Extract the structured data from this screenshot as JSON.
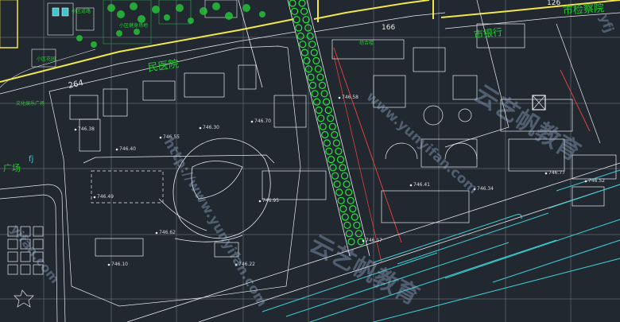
{
  "drawing": {
    "background": "#212830",
    "colors": {
      "boundary": "#f2e64d",
      "green_text": "#1fcf2a",
      "tree": "#22e83a",
      "red_line": "#e0403c",
      "cyan": "#3ec6cc",
      "grid": "#c8d2dc",
      "lines": "#e8ecef"
    }
  },
  "labels": {
    "min_yi_yuan": "民医院",
    "shi_jian_cha_yuan": "市检察院",
    "shi_yin_hang": "市银行",
    "guang_chang": "广场",
    "lot_264": "264",
    "lot_166": "166",
    "lot_126": "126",
    "small_1": "小区道路",
    "small_2": "小区健身场地",
    "small_3": "小区花园",
    "small_4": "文化娱乐广场",
    "small_5": "综合楼",
    "left_tag": "fj"
  },
  "watermarks": {
    "brand_1": "云艺帆教育",
    "brand_2": "云艺帆教育",
    "url_1": "www.yunyifan.com",
    "url_2": "http://www.yunyifan.com",
    "url_3": "yifan.com",
    "url_4": "yfj"
  },
  "annotations": {
    "elev_1": "746.38",
    "elev_2": "746.40",
    "elev_3": "746.55",
    "elev_4": "746.30",
    "elev_5": "746.70",
    "elev_6": "746.49",
    "elev_7": "746.62",
    "elev_8": "746.95",
    "elev_9": "746.10",
    "elev_10": "746.22",
    "elev_11": "746.58",
    "elev_12": "746.41",
    "elev_13": "746.34",
    "elev_14": "746.77",
    "elev_15": "746.52",
    "elev_16": "746.17"
  }
}
